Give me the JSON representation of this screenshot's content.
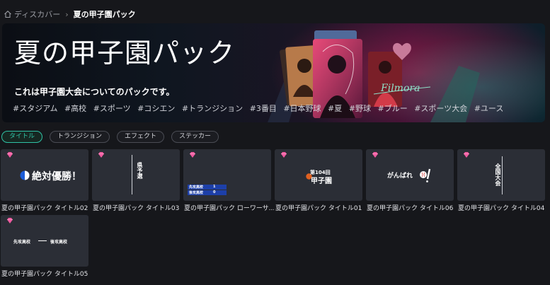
{
  "breadcrumb": {
    "home_icon": "home-icon",
    "root": "ディスカバー",
    "separator": "›",
    "current": "夏の甲子園パック"
  },
  "banner": {
    "title": "夏の甲子園パック",
    "description": "これは甲子園大会についてのパックです。",
    "tags": [
      "#スタジアム",
      "#高校",
      "#スポーツ",
      "#コシエン",
      "#トランジション",
      "#3番目",
      "#日本野球",
      "#夏",
      "#野球",
      "#ブルー",
      "#スポーツ大会",
      "#ユース"
    ],
    "art_text": "Filmora"
  },
  "filters": [
    {
      "label": "タイトル",
      "active": true
    },
    {
      "label": "トランジション",
      "active": false
    },
    {
      "label": "エフェクト",
      "active": false
    },
    {
      "label": "ステッカー",
      "active": false
    }
  ],
  "cards": [
    {
      "label": "夏の甲子園パック タイトル02",
      "preview": "絶対優勝！"
    },
    {
      "label": "夏の甲子園パック タイトル03",
      "preview": "県予選"
    },
    {
      "label": "夏の甲子園パック ローワーサ...",
      "preview_a": "先攻高校",
      "preview_b": "後攻高校",
      "score_a": "1",
      "score_b": "0"
    },
    {
      "label": "夏の甲子園パック タイトル01",
      "preview_small": "第104回",
      "preview": "甲子園"
    },
    {
      "label": "夏の甲子園パック タイトル06",
      "preview": "がんばれ"
    },
    {
      "label": "夏の甲子園パック タイトル04",
      "preview": "全国大会"
    },
    {
      "label": "夏の甲子園パック タイトル05",
      "preview_a": "先攻高校",
      "preview_b": "後攻高校"
    }
  ],
  "colors": {
    "accent": "#2fc2a5",
    "premium_gem": "#f05aa0",
    "background": "#16171b",
    "card": "#2b2e36"
  }
}
